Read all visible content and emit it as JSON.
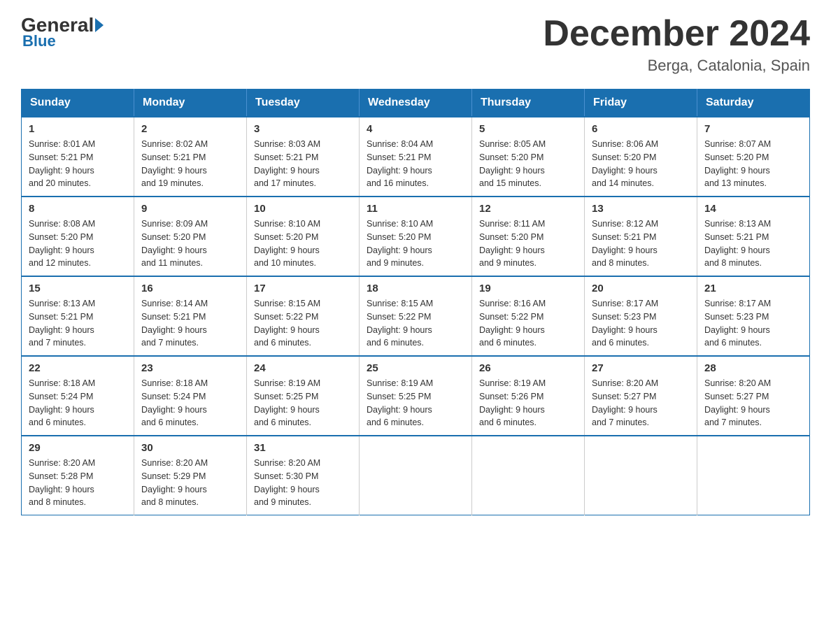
{
  "logo": {
    "general": "General",
    "blue": "Blue"
  },
  "title": "December 2024",
  "subtitle": "Berga, Catalonia, Spain",
  "days_of_week": [
    "Sunday",
    "Monday",
    "Tuesday",
    "Wednesday",
    "Thursday",
    "Friday",
    "Saturday"
  ],
  "weeks": [
    [
      {
        "day": "1",
        "sunrise": "8:01 AM",
        "sunset": "5:21 PM",
        "daylight": "9 hours and 20 minutes."
      },
      {
        "day": "2",
        "sunrise": "8:02 AM",
        "sunset": "5:21 PM",
        "daylight": "9 hours and 19 minutes."
      },
      {
        "day": "3",
        "sunrise": "8:03 AM",
        "sunset": "5:21 PM",
        "daylight": "9 hours and 17 minutes."
      },
      {
        "day": "4",
        "sunrise": "8:04 AM",
        "sunset": "5:21 PM",
        "daylight": "9 hours and 16 minutes."
      },
      {
        "day": "5",
        "sunrise": "8:05 AM",
        "sunset": "5:20 PM",
        "daylight": "9 hours and 15 minutes."
      },
      {
        "day": "6",
        "sunrise": "8:06 AM",
        "sunset": "5:20 PM",
        "daylight": "9 hours and 14 minutes."
      },
      {
        "day": "7",
        "sunrise": "8:07 AM",
        "sunset": "5:20 PM",
        "daylight": "9 hours and 13 minutes."
      }
    ],
    [
      {
        "day": "8",
        "sunrise": "8:08 AM",
        "sunset": "5:20 PM",
        "daylight": "9 hours and 12 minutes."
      },
      {
        "day": "9",
        "sunrise": "8:09 AM",
        "sunset": "5:20 PM",
        "daylight": "9 hours and 11 minutes."
      },
      {
        "day": "10",
        "sunrise": "8:10 AM",
        "sunset": "5:20 PM",
        "daylight": "9 hours and 10 minutes."
      },
      {
        "day": "11",
        "sunrise": "8:10 AM",
        "sunset": "5:20 PM",
        "daylight": "9 hours and 9 minutes."
      },
      {
        "day": "12",
        "sunrise": "8:11 AM",
        "sunset": "5:20 PM",
        "daylight": "9 hours and 9 minutes."
      },
      {
        "day": "13",
        "sunrise": "8:12 AM",
        "sunset": "5:21 PM",
        "daylight": "9 hours and 8 minutes."
      },
      {
        "day": "14",
        "sunrise": "8:13 AM",
        "sunset": "5:21 PM",
        "daylight": "9 hours and 8 minutes."
      }
    ],
    [
      {
        "day": "15",
        "sunrise": "8:13 AM",
        "sunset": "5:21 PM",
        "daylight": "9 hours and 7 minutes."
      },
      {
        "day": "16",
        "sunrise": "8:14 AM",
        "sunset": "5:21 PM",
        "daylight": "9 hours and 7 minutes."
      },
      {
        "day": "17",
        "sunrise": "8:15 AM",
        "sunset": "5:22 PM",
        "daylight": "9 hours and 6 minutes."
      },
      {
        "day": "18",
        "sunrise": "8:15 AM",
        "sunset": "5:22 PM",
        "daylight": "9 hours and 6 minutes."
      },
      {
        "day": "19",
        "sunrise": "8:16 AM",
        "sunset": "5:22 PM",
        "daylight": "9 hours and 6 minutes."
      },
      {
        "day": "20",
        "sunrise": "8:17 AM",
        "sunset": "5:23 PM",
        "daylight": "9 hours and 6 minutes."
      },
      {
        "day": "21",
        "sunrise": "8:17 AM",
        "sunset": "5:23 PM",
        "daylight": "9 hours and 6 minutes."
      }
    ],
    [
      {
        "day": "22",
        "sunrise": "8:18 AM",
        "sunset": "5:24 PM",
        "daylight": "9 hours and 6 minutes."
      },
      {
        "day": "23",
        "sunrise": "8:18 AM",
        "sunset": "5:24 PM",
        "daylight": "9 hours and 6 minutes."
      },
      {
        "day": "24",
        "sunrise": "8:19 AM",
        "sunset": "5:25 PM",
        "daylight": "9 hours and 6 minutes."
      },
      {
        "day": "25",
        "sunrise": "8:19 AM",
        "sunset": "5:25 PM",
        "daylight": "9 hours and 6 minutes."
      },
      {
        "day": "26",
        "sunrise": "8:19 AM",
        "sunset": "5:26 PM",
        "daylight": "9 hours and 6 minutes."
      },
      {
        "day": "27",
        "sunrise": "8:20 AM",
        "sunset": "5:27 PM",
        "daylight": "9 hours and 7 minutes."
      },
      {
        "day": "28",
        "sunrise": "8:20 AM",
        "sunset": "5:27 PM",
        "daylight": "9 hours and 7 minutes."
      }
    ],
    [
      {
        "day": "29",
        "sunrise": "8:20 AM",
        "sunset": "5:28 PM",
        "daylight": "9 hours and 8 minutes."
      },
      {
        "day": "30",
        "sunrise": "8:20 AM",
        "sunset": "5:29 PM",
        "daylight": "9 hours and 8 minutes."
      },
      {
        "day": "31",
        "sunrise": "8:20 AM",
        "sunset": "5:30 PM",
        "daylight": "9 hours and 9 minutes."
      },
      null,
      null,
      null,
      null
    ]
  ],
  "labels": {
    "sunrise": "Sunrise:",
    "sunset": "Sunset:",
    "daylight": "Daylight:"
  }
}
